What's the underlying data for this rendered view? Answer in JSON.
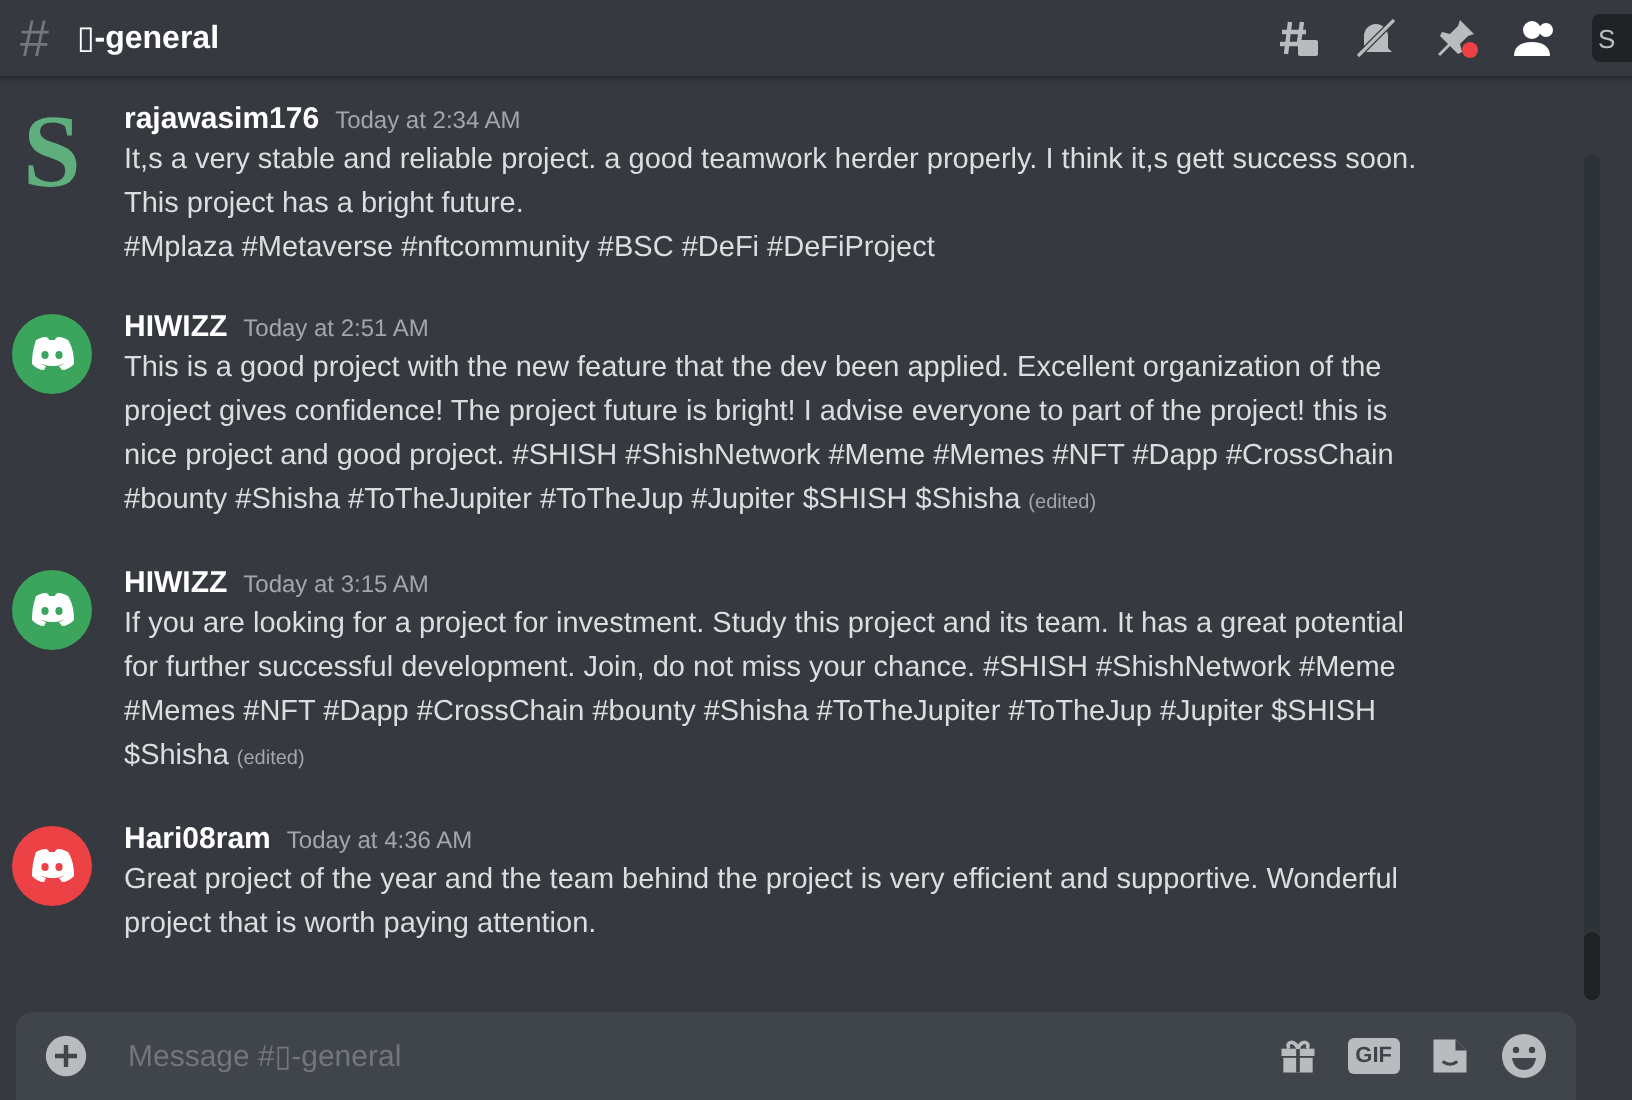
{
  "header": {
    "channel_icon": "#",
    "channel_name": "▯-general",
    "search_placeholder": "S"
  },
  "messages": [
    {
      "author": "rajawasim176",
      "time": "Today at 2:34 AM",
      "avatar": {
        "kind": "letter",
        "letter": "S",
        "color": "#5fae7e"
      },
      "lines": [
        "It,s a very stable and reliable project. a good teamwork herder properly. I think it,s gett success soon.",
        "This project has a bright future.",
        "#Mplaza #Metaverse #nftcommunity #BSC  #DeFi #DeFiProject"
      ]
    },
    {
      "author": "HIWIZZ",
      "time": "Today at 2:51 AM",
      "avatar": {
        "kind": "logo",
        "color": "#3ba55d"
      },
      "lines": [
        "This is a good project with the new feature that the dev been applied.  Excellent organization of the",
        "project gives confidence! The project future is bright! I advise everyone to part of the project! this is",
        "nice project and good project. #SHISH #ShishNetwork #Meme #Memes #NFT #Dapp #CrossChain",
        "#bounty #Shisha #ToTheJupiter #ToTheJup #Jupiter $SHISH $Shisha"
      ],
      "edited_label": "(edited)"
    },
    {
      "author": "HIWIZZ",
      "time": "Today at 3:15 AM",
      "avatar": {
        "kind": "logo",
        "color": "#3ba55d"
      },
      "lines": [
        "If you are looking for a project for investment. Study this project and its team. It has a great potential",
        "for further successful development. Join, do not miss your chance. #SHISH #ShishNetwork #Meme",
        "#Memes #NFT #Dapp #CrossChain #bounty #Shisha #ToTheJupiter #ToTheJup #Jupiter $SHISH",
        "$Shisha"
      ],
      "edited_label": "(edited)"
    },
    {
      "author": "Hari08ram",
      "time": "Today at 4:36 AM",
      "avatar": {
        "kind": "logo",
        "color": "#ed4245"
      },
      "lines": [
        "Great  project of the year and the team behind the project is very efficient and supportive. Wonderful",
        "project that is worth paying attention."
      ]
    }
  ],
  "composer": {
    "placeholder": "Message #▯-general",
    "gif_label": "GIF"
  }
}
